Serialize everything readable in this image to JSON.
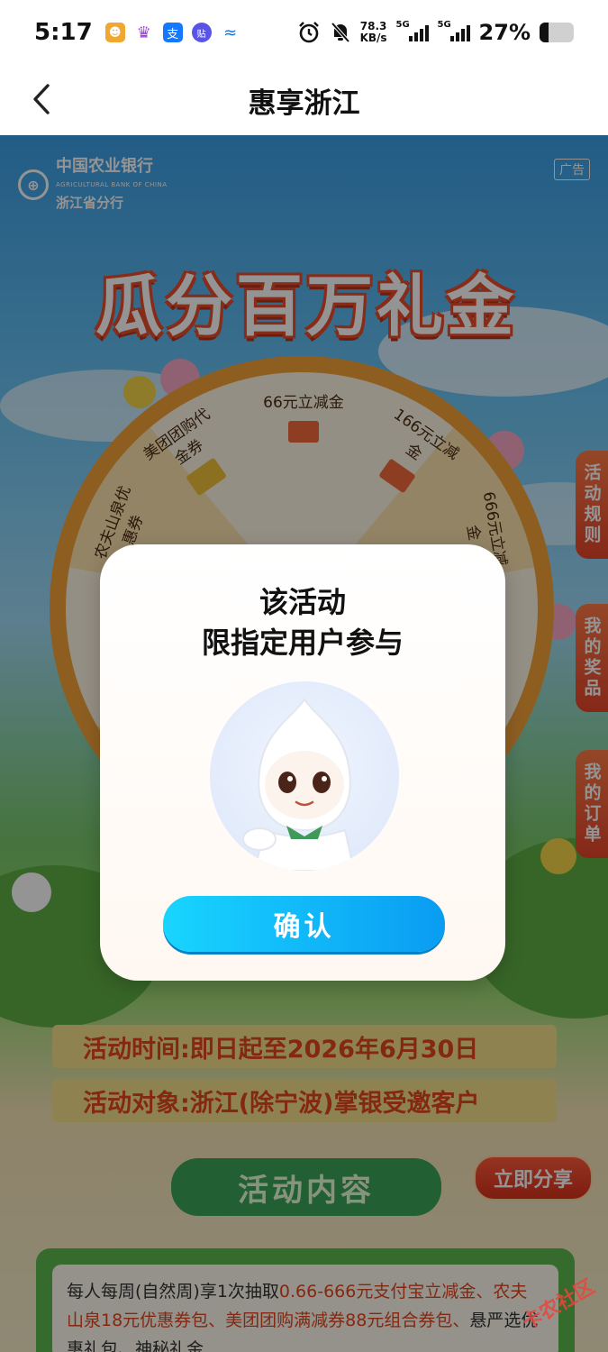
{
  "status_bar": {
    "time": "5:17",
    "net_speed_value": "78.3",
    "net_speed_unit": "KB/s",
    "signal_1_label": "5G",
    "signal_2_label": "5G",
    "battery_text": "27%",
    "battery_level": 0.27
  },
  "nav": {
    "title": "惠享浙江"
  },
  "banner": {
    "bank_name_cn": "中国农业银行",
    "bank_name_en": "AGRICULTURAL BANK OF CHINA",
    "bank_branch": "浙江省分行",
    "ad_tag": "广告",
    "headline": "瓜分百万礼金",
    "prizes": {
      "meituan": "美团团购代金券",
      "p66": "66元立减金",
      "p166": "166元立减金",
      "nongfu": "农夫山泉优惠券",
      "p666": "666元立减金"
    },
    "side_tabs": {
      "rules": "活动规则",
      "my_prizes": "我的奖品",
      "my_orders": "我的订单"
    },
    "activity_time": "活动时间:即日起至2026年6月30日",
    "activity_target": "活动对象:浙江(除宁波)掌银受邀客户",
    "section_header": "活动内容",
    "share_button": "立即分享",
    "content_text_1": "每人每周(自然周)享1次抽取",
    "content_text_hl": "0.66-666元支付宝立减金、农夫山泉18元优惠券包、美团团购满减券88元组合券包、",
    "content_text_2": "悬严选优惠礼包、神秘礼金"
  },
  "dialog": {
    "title_line_1": "该活动",
    "title_line_2": "限指定用户参与",
    "confirm_label": "确认"
  },
  "watermark": "卡农社区"
}
